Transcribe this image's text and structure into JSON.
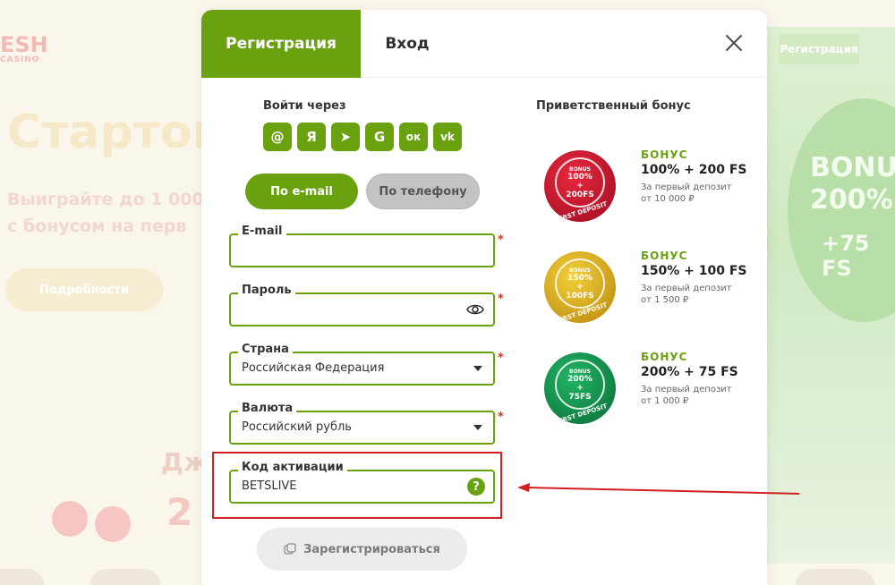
{
  "background": {
    "logo_top": "ESH",
    "logo_bottom": "CASINO",
    "title": "Стартов",
    "subtitle_line1": "Выиграйте до 1 000",
    "subtitle_line2": "с бонусом на перв",
    "more_button": "Подробности",
    "jackpot_label": "Дж",
    "jackpot_value": "2",
    "right_tab": "Регистрация",
    "right_bonus_line1": "BONUS",
    "right_bonus_line2": "200%",
    "right_bonus_line3": "+75 FS"
  },
  "modal": {
    "tabs": {
      "register": "Регистрация",
      "login": "Вход"
    },
    "login_via": "Войти через",
    "social_icons": [
      "email-icon",
      "yandex-icon",
      "telegram-icon",
      "google-icon",
      "odnoklassniki-icon",
      "vk-icon"
    ],
    "social_glyphs": [
      "@",
      "Я",
      "➤",
      "G",
      "ок",
      "vk"
    ],
    "method": {
      "email": "По e-mail",
      "phone": "По телефону"
    },
    "fields": {
      "email": {
        "label": "E-mail",
        "value": ""
      },
      "password": {
        "label": "Пароль",
        "value": ""
      },
      "country": {
        "label": "Страна",
        "value": "Российская Федерация"
      },
      "currency": {
        "label": "Валюта",
        "value": "Российский рубль"
      },
      "activation_code": {
        "label": "Код активации",
        "value": "BETSLIVE"
      }
    },
    "required_mark": "*",
    "help_glyph": "?",
    "submit": "Зарегистрироваться",
    "bonus_heading": "Приветственный бонус",
    "bonuses": [
      {
        "label": "БОНУС",
        "amount": "100% + 200 FS",
        "desc1": "За первый депозит",
        "desc2": "от 10 000 ₽",
        "badge_top": "BONUS",
        "badge_main1": "100%",
        "badge_plus": "+",
        "badge_main2": "200FS",
        "badge_arc": "FIRST DEPOSIT",
        "color": "#c8102e"
      },
      {
        "label": "БОНУС",
        "amount": "150% + 100 FS",
        "desc1": "За первый депозит",
        "desc2": "от 1 500 ₽",
        "badge_top": "BONUS",
        "badge_main1": "150%",
        "badge_plus": "+",
        "badge_main2": "100FS",
        "badge_arc": "FIRST DEPOSIT",
        "color": "#d9a80f"
      },
      {
        "label": "БОНУС",
        "amount": "200% + 75 FS",
        "desc1": "За первый депозит",
        "desc2": "от 1 000 ₽",
        "badge_top": "BONUS",
        "badge_main1": "200%",
        "badge_plus": "+",
        "badge_main2": "75FS",
        "badge_arc": "FIRST DEPOSIT",
        "color": "#0f8c4a"
      }
    ]
  },
  "colors": {
    "accent": "#6aa20f",
    "highlight": "#d21f1f",
    "required": "#e0301e"
  }
}
